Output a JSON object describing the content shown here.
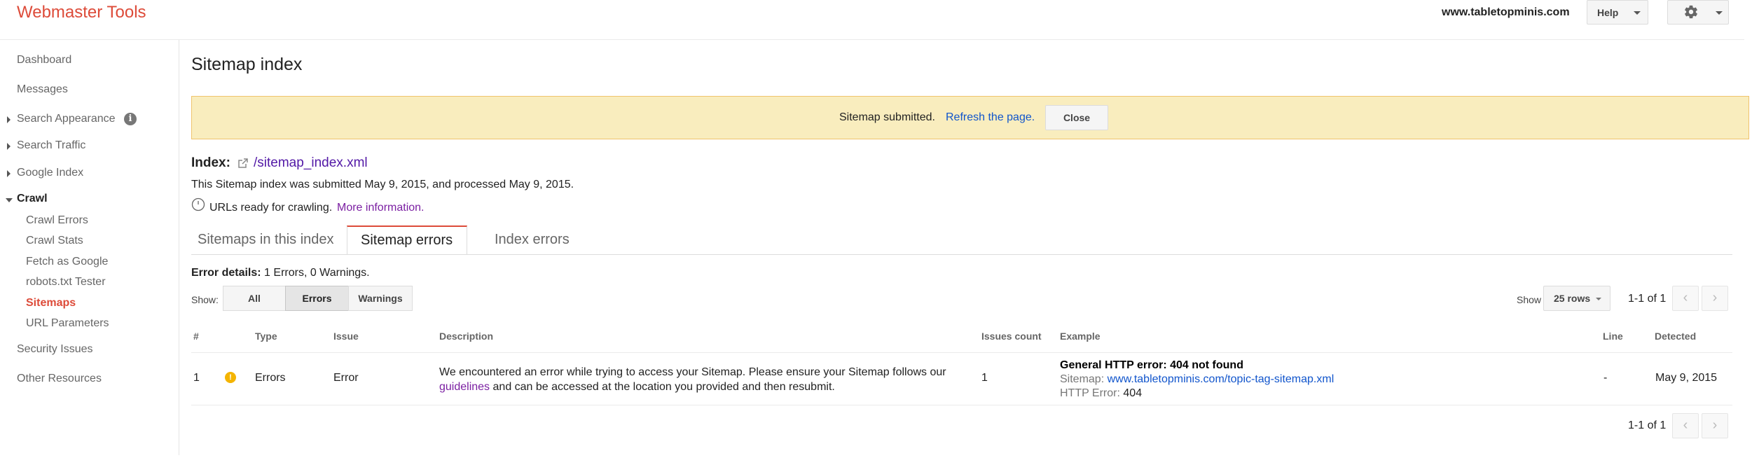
{
  "header": {
    "logo": "Webmaster Tools",
    "site": "www.tabletopminis.com",
    "help_label": "Help"
  },
  "sidebar": {
    "dashboard": "Dashboard",
    "messages": "Messages",
    "search_appearance": "Search Appearance",
    "search_traffic": "Search Traffic",
    "google_index": "Google Index",
    "crawl": "Crawl",
    "crawl_items": [
      "Crawl Errors",
      "Crawl Stats",
      "Fetch as Google",
      "robots.txt Tester",
      "Sitemaps",
      "URL Parameters"
    ],
    "security_issues": "Security Issues",
    "other_resources": "Other Resources"
  },
  "main": {
    "title": "Sitemap index",
    "banner": {
      "text": "Sitemap submitted.",
      "link": "Refresh the page.",
      "close": "Close"
    },
    "index_label": "Index:",
    "index_link": "/sitemap_index.xml",
    "submitted_text": "This Sitemap index was submitted May 9, 2015, and processed May 9, 2015.",
    "urls_text": "URLs ready for crawling.",
    "urls_link": "More information.",
    "tabs": [
      "Sitemaps in this index",
      "Sitemap errors",
      "Index errors"
    ],
    "error_details_label": "Error details:",
    "error_details_value": "1 Errors, 0 Warnings.",
    "show_label": "Show:",
    "filters": [
      "All",
      "Errors",
      "Warnings"
    ],
    "rows_show_label": "Show",
    "rows_value": "25 rows",
    "pager_text": "1-1 of 1"
  },
  "table": {
    "headers": [
      "#",
      "Type",
      "Issue",
      "Description",
      "Issues count",
      "Example",
      "Line",
      "Detected"
    ],
    "row": {
      "num": "1",
      "type": "Errors",
      "issue": "Error",
      "desc_before": "We encountered an error while trying to access your Sitemap. Please ensure your Sitemap follows our",
      "desc_link": "guidelines",
      "desc_after": "and can be accessed at the location you provided and then resubmit.",
      "count": "1",
      "example_title": "General HTTP error: 404 not found",
      "example_sitemap_label": "Sitemap:",
      "example_sitemap_url": "www.tabletopminis.com/topic-tag-sitemap.xml",
      "example_http_label": "HTTP Error:",
      "example_http_value": "404",
      "line": "-",
      "detected": "May 9, 2015"
    }
  },
  "colors": {
    "brand_red": "#dd4b39",
    "banner_bg": "#f9edbe",
    "link_blue": "#1155cc",
    "link_purple": "#7b1fa2",
    "warning": "#f4b400"
  }
}
